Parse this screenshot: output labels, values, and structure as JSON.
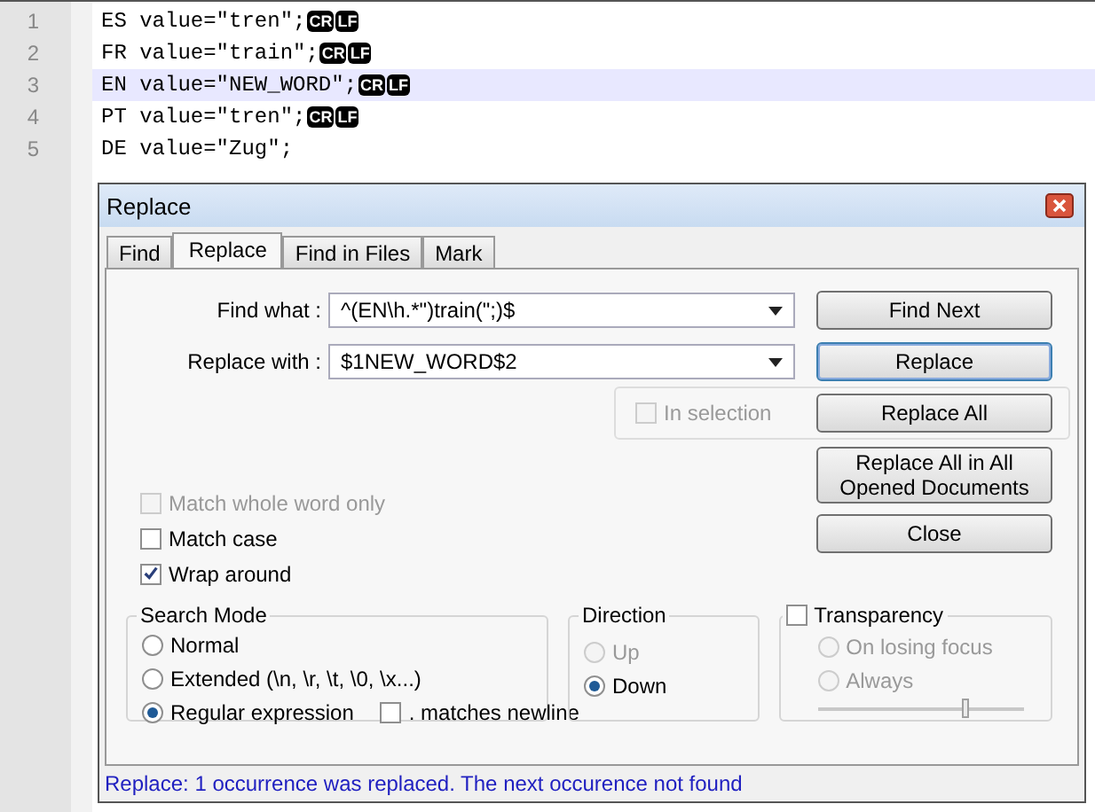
{
  "editor": {
    "lines": [
      {
        "number": "1",
        "text": "ES value=\"tren\";",
        "eol": [
          "CR",
          "LF"
        ],
        "current": false
      },
      {
        "number": "2",
        "text": "FR value=\"train\";",
        "eol": [
          "CR",
          "LF"
        ],
        "current": false
      },
      {
        "number": "3",
        "text": "EN value=\"NEW_WORD\";",
        "eol": [
          "CR",
          "LF"
        ],
        "current": true
      },
      {
        "number": "4",
        "text": "PT value=\"tren\";",
        "eol": [
          "CR",
          "LF"
        ],
        "current": false
      },
      {
        "number": "5",
        "text": "DE value=\"Zug\";",
        "current": false
      }
    ]
  },
  "dialog": {
    "title": "Replace",
    "tabs": [
      {
        "label": "Find",
        "selected": false
      },
      {
        "label": "Replace",
        "selected": true
      },
      {
        "label": "Find in Files",
        "selected": false
      },
      {
        "label": "Mark",
        "selected": false
      }
    ],
    "fields": [
      {
        "label": "Find what :",
        "value": "^(EN\\h.*\")train(\";)$"
      },
      {
        "label": "Replace with :",
        "value": "$1NEW_WORD$2"
      }
    ],
    "buttons": [
      {
        "label": "Find Next",
        "focused": false
      },
      {
        "label": "Replace",
        "focused": true
      },
      {
        "label": "Replace All",
        "focused": false
      },
      {
        "label": "Replace All in All Opened Documents",
        "focused": false
      },
      {
        "label": "Close",
        "focused": false
      }
    ],
    "in_selection": {
      "label": "In selection",
      "checked": false,
      "disabled": true
    },
    "options": [
      {
        "label": "Match whole word only",
        "checked": false,
        "disabled": true
      },
      {
        "label": "Match case",
        "checked": false,
        "disabled": false
      },
      {
        "label": "Wrap around",
        "checked": true,
        "disabled": false
      }
    ],
    "search_mode": {
      "title": "Search Mode",
      "options": [
        {
          "label": "Normal",
          "selected": false
        },
        {
          "label": "Extended (\\n, \\r, \\t, \\0, \\x...)",
          "selected": false
        },
        {
          "label": "Regular expression",
          "selected": true
        }
      ],
      "matches_newline": {
        "label": ". matches newline",
        "checked": false
      }
    },
    "direction": {
      "title": "Direction",
      "options": [
        {
          "label": "Up",
          "selected": false,
          "disabled": true
        },
        {
          "label": "Down",
          "selected": true,
          "disabled": false
        }
      ]
    },
    "transparency": {
      "label": "Transparency",
      "checked": false,
      "options": [
        {
          "label": "On losing focus",
          "selected": false,
          "disabled": true
        },
        {
          "label": "Always",
          "selected": false,
          "disabled": true
        }
      ],
      "slider": {
        "level": 0.72,
        "disabled": true
      }
    },
    "status": "Replace: 1 occurrence was replaced. The next occurence not found"
  }
}
